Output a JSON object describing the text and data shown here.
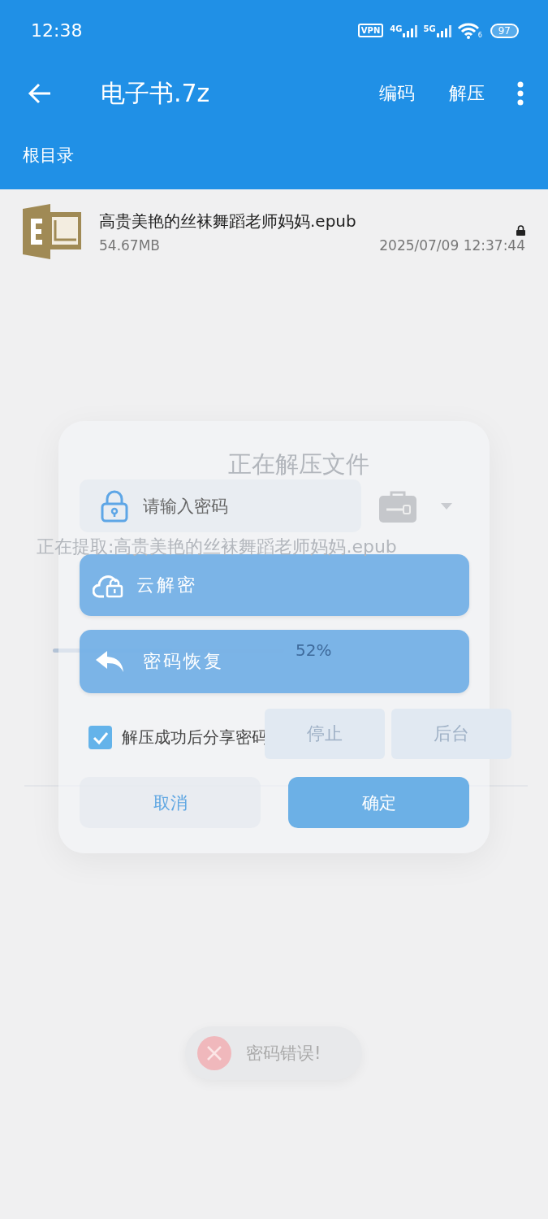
{
  "status_bar": {
    "time": "12:38",
    "vpn": "VPN",
    "networks": [
      "4G",
      "5G"
    ],
    "wifi_badge": "6",
    "battery": "97"
  },
  "app_bar": {
    "title": "电子书.7z",
    "actions": [
      "编码",
      "解压"
    ]
  },
  "breadcrumb": "根目录",
  "files": [
    {
      "name": "高贵美艳的丝袜舞蹈老师妈妈.epub",
      "size": "54.67MB",
      "date": "2025/07/09 12:37:44",
      "locked": true
    }
  ],
  "progress_dialog": {
    "title": "正在解压文件",
    "message": "正在提取:高贵美艳的丝袜舞蹈老师妈妈.epub",
    "level": 0.52,
    "percent": "52%",
    "buttons": [
      "停止",
      "后台"
    ]
  },
  "password_dialog": {
    "placeholder": "请输入密码",
    "options": [
      {
        "kind": "cloud",
        "label": "云解密"
      },
      {
        "kind": "restore",
        "label": "密码恢复"
      }
    ],
    "share_checkbox": {
      "label": "解压成功后分享密码",
      "checked": true
    },
    "cancel": "取消",
    "confirm": "确定"
  },
  "toast": {
    "message": "密码错误!"
  }
}
